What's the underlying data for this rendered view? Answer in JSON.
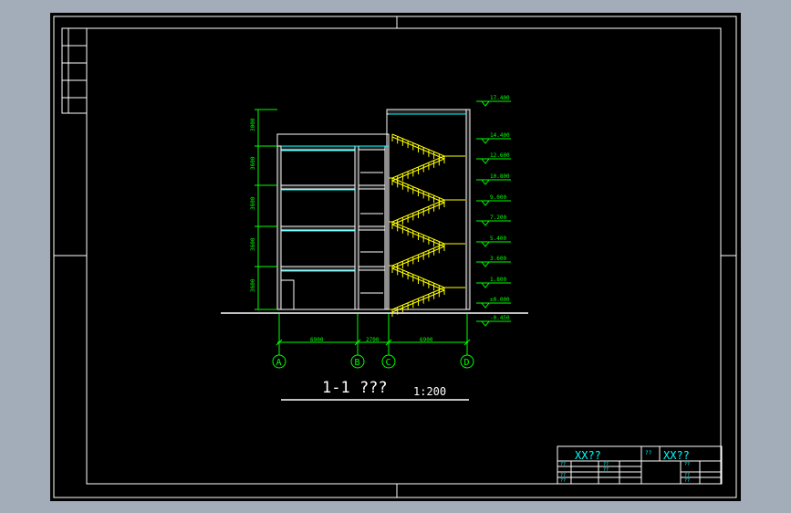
{
  "colors": {
    "background": "#000000",
    "frame": "#ffffff",
    "dimension": "#00ff00",
    "stair": "#ffff00",
    "slab": "#00ffff",
    "title_text": "#ffffff"
  },
  "section": {
    "title": "1-1 ???",
    "scale": "1:200"
  },
  "elevations": [
    "17.400",
    "14.400",
    "12.600",
    "10.800",
    "9.000",
    "7.200",
    "5.400",
    "3.600",
    "1.800",
    "±0.000",
    "-0.450"
  ],
  "vertical_dims": [
    "3600",
    "3600",
    "3600",
    "3600",
    "3000"
  ],
  "horizontal_dims": [
    "6900",
    "2700",
    "6900"
  ],
  "axes": [
    "A",
    "B",
    "C",
    "D"
  ],
  "title_block": {
    "project": "XX??",
    "drawing": "XX??",
    "label_a": "??",
    "cells": [
      "??",
      "??",
      "??",
      "??",
      "??",
      "??",
      "??",
      "??"
    ]
  }
}
